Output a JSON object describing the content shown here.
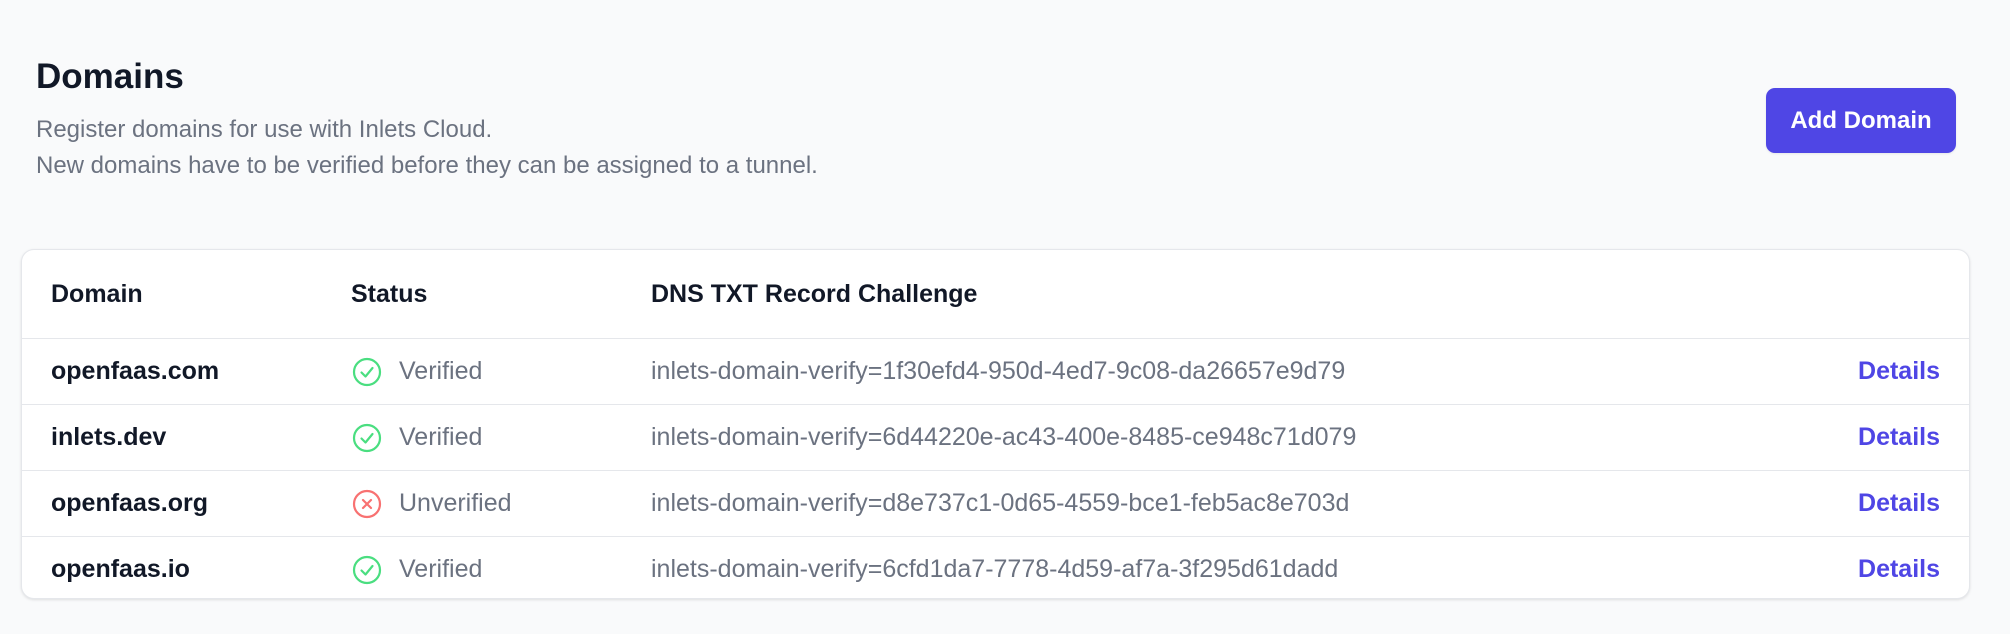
{
  "page": {
    "title": "Domains",
    "description_line1": "Register domains for use with Inlets Cloud.",
    "description_line2": "New domains have to be verified before they can be assigned to a tunnel.",
    "add_button_label": "Add Domain"
  },
  "colors": {
    "accent": "#4f46e5",
    "verified": "#4ade80",
    "unverified": "#f87171",
    "muted_text": "#6b7280"
  },
  "table": {
    "headers": {
      "domain": "Domain",
      "status": "Status",
      "dns": "DNS TXT Record Challenge"
    },
    "rows": [
      {
        "domain": "openfaas.com",
        "status": "Verified",
        "status_icon": "check-circle-icon",
        "dns": "inlets-domain-verify=1f30efd4-950d-4ed7-9c08-da26657e9d79",
        "action": "Details"
      },
      {
        "domain": "inlets.dev",
        "status": "Verified",
        "status_icon": "check-circle-icon",
        "dns": "inlets-domain-verify=6d44220e-ac43-400e-8485-ce948c71d079",
        "action": "Details"
      },
      {
        "domain": "openfaas.org",
        "status": "Unverified",
        "status_icon": "x-circle-icon",
        "dns": "inlets-domain-verify=d8e737c1-0d65-4559-bce1-feb5ac8e703d",
        "action": "Details"
      },
      {
        "domain": "openfaas.io",
        "status": "Verified",
        "status_icon": "check-circle-icon",
        "dns": "inlets-domain-verify=6cfd1da7-7778-4d59-af7a-3f295d61dadd",
        "action": "Details"
      }
    ]
  }
}
